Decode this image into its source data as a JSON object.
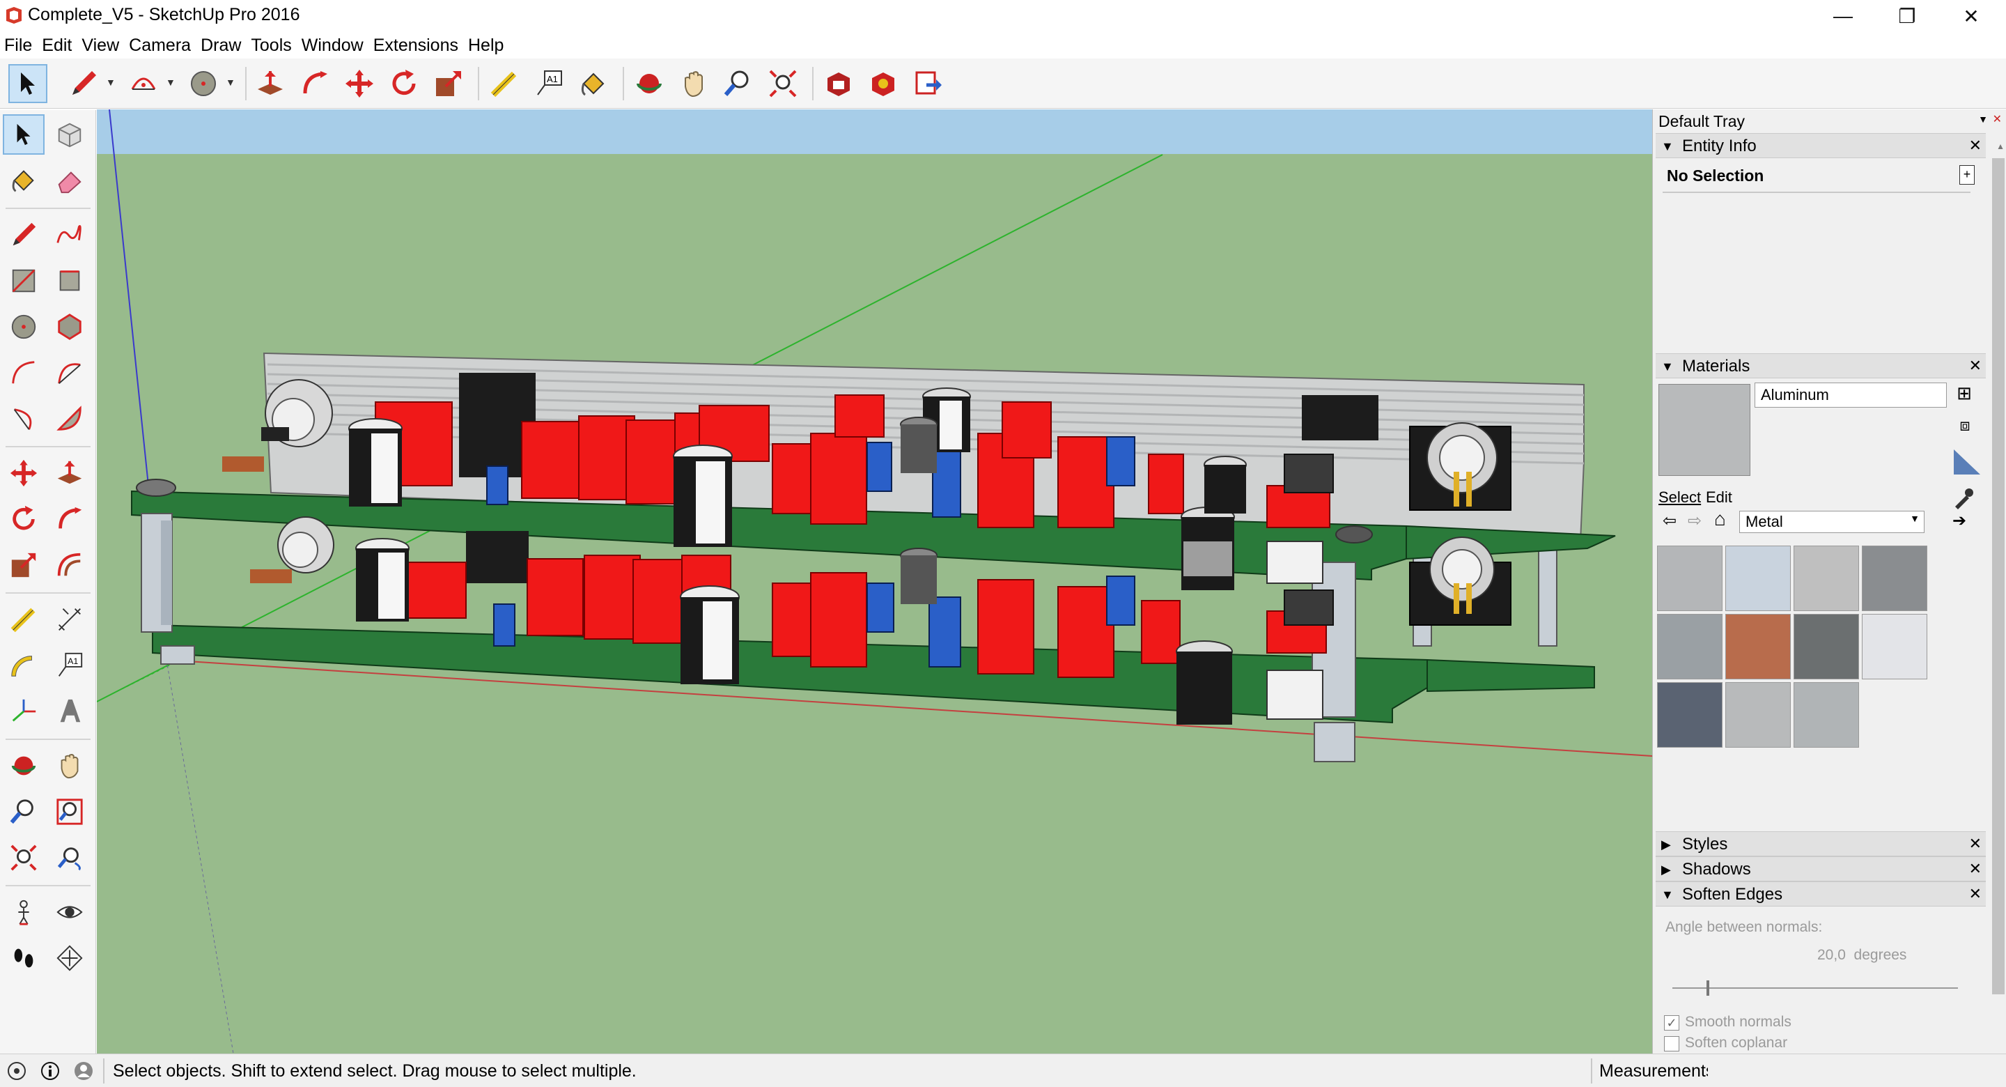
{
  "window": {
    "title": "Complete_V5 - SketchUp Pro 2016",
    "minimize": "—",
    "maximize": "❐",
    "close": "✕"
  },
  "menu": [
    "File",
    "Edit",
    "View",
    "Camera",
    "Draw",
    "Tools",
    "Window",
    "Extensions",
    "Help"
  ],
  "tray": {
    "title": "Default Tray",
    "entity_info": {
      "header": "Entity Info",
      "selection": "No Selection"
    },
    "materials": {
      "header": "Materials",
      "current_material": "Aluminum",
      "tab_select": "Select",
      "tab_edit": "Edit",
      "library": "Metal",
      "swatch_colors": [
        "#b4b6b8",
        "#c9d3de",
        "#bfbfbf",
        "#8a8d90",
        "#9aa0a4",
        "#b86c4c",
        "#6b6f70",
        "#e3e4e8",
        "#5a6372",
        "#b8babb",
        "#b0b4b6"
      ]
    },
    "styles": {
      "header": "Styles"
    },
    "shadows": {
      "header": "Shadows"
    },
    "soften_edges": {
      "header": "Soften Edges",
      "angle_label": "Angle between normals:",
      "angle_value": "20,0  degrees",
      "slider_fraction": 0.12,
      "smooth_normals_label": "Smooth normals",
      "smooth_normals_checked": true,
      "soften_coplanar_label": "Soften coplanar",
      "soften_coplanar_checked": false
    }
  },
  "status": {
    "message": "Select objects. Shift to extend select. Drag mouse to select multiple.",
    "measurements_label": "Measurements"
  },
  "colors": {
    "sky": "#a7cde8",
    "ground": "#98bb8c",
    "pcb": "#2a7a3a",
    "component_red": "#f01818",
    "trim_blue": "#2a5fc8",
    "axis_red": "#c44040",
    "axis_green": "#2db32d",
    "axis_blue": "#3a3acc"
  }
}
